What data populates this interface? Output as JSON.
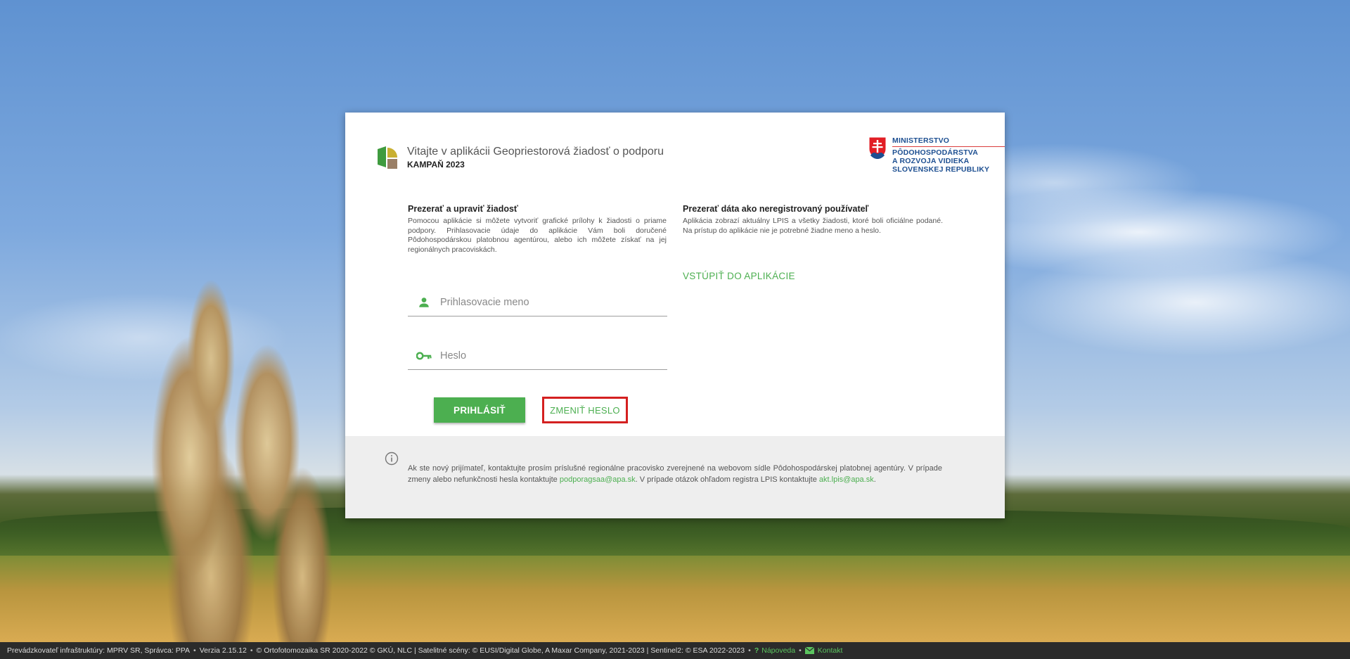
{
  "header": {
    "title": "Vitajte v aplikácii Geopriestorová žiadosť o podporu",
    "campaign": "KAMPAŇ 2023",
    "app_logo_icon": "app-logo-icon"
  },
  "ministry": {
    "line1": "MINISTERSTVO",
    "line2": "PÔDOHOSPODÁRSTVA",
    "line3": "A ROZVOJA VIDIEKA",
    "line4": "SLOVENSKEJ REPUBLIKY",
    "crest_icon": "slovak-coat-of-arms-icon"
  },
  "left_section": {
    "heading": "Prezerať a upraviť žiadosť",
    "text": "Pomocou aplikácie si môžete vytvoriť grafické prílohy k žiadosti o priame podpory. Prihlasovacie údaje do aplikácie Vám boli doručené Pôdohospodárskou platobnou agentúrou, alebo ich môžete získať na jej regionálnych pracoviskách."
  },
  "right_section": {
    "heading": "Prezerať dáta ako neregistrovaný používateľ",
    "text": "Aplikácia zobrazí aktuálny LPIS a všetky žiadosti, ktoré boli oficiálne podané. Na prístup do aplikácie nie je potrebné žiadne meno a heslo.",
    "enter_link": "VSTÚPIŤ DO APLIKÁCIE"
  },
  "form": {
    "username": {
      "placeholder": "Prihlasovacie meno",
      "value": "",
      "icon": "person-icon"
    },
    "password": {
      "placeholder": "Heslo",
      "value": "",
      "icon": "key-icon"
    },
    "login_label": "PRIHLÁSIŤ",
    "change_password_label": "ZMENIŤ HESLO"
  },
  "info": {
    "text_before": "Ak ste nový prijímateľ, kontaktujte prosím príslušné regionálne pracovisko zverejnené na webovom sídle Pôdohospodárskej platobnej agentúry. V prípade zmeny alebo nefunkčnosti hesla kontaktujte ",
    "email1": "podporagsaa@apa.sk",
    "text_middle": ". V prípade otázok ohľadom registra LPIS kontaktujte ",
    "email2": "akt.lpis@apa.sk",
    "text_after": ".",
    "icon": "info-icon"
  },
  "statusbar": {
    "operator": "Prevádzkovateľ infraštruktúry: MPRV SR, Správca: PPA",
    "version": "Verzia 2.15.12",
    "credits": "© Ortofotomozaika SR 2020-2022 © GKÚ, NLC | Satelitné scény: © EUSI/Digital Globe, A Maxar Company, 2021-2023 | Sentinel2: © ESA 2022-2023",
    "separator": "•",
    "help_label": "Nápoveda",
    "help_icon": "question-icon",
    "help_glyph": "?",
    "contact_label": "Kontakt",
    "contact_icon": "mail-icon"
  },
  "colors": {
    "accent": "#4caf50",
    "highlight_border": "#d42020",
    "ministry_blue": "#1d4f91"
  }
}
